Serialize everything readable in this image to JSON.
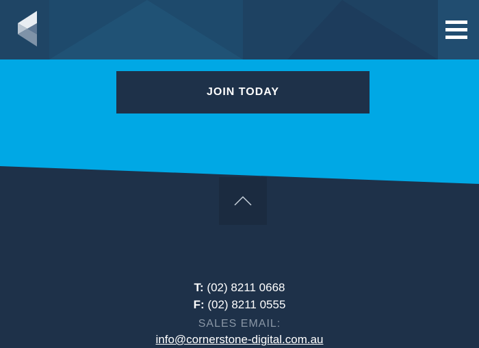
{
  "header": {
    "logo_icon": "cornerstone-logo-icon",
    "menu_icon": "hamburger-menu-icon"
  },
  "cta": {
    "join_label": "JOIN TODAY"
  },
  "back_to_top": {
    "icon": "chevron-up-icon"
  },
  "contact": {
    "phone_label": "T:",
    "phone_value": "(02) 8211 0668",
    "fax_label": "F:",
    "fax_value": "(02) 8211 0555",
    "sales_email_label": "SALES EMAIL:",
    "sales_email": "info@cornerstone-digital.com.au"
  },
  "colors": {
    "header_bg": "#1f4565",
    "accent_blue": "#00a8e5",
    "navy": "#1e3149",
    "muted_text": "#8a97a6"
  }
}
